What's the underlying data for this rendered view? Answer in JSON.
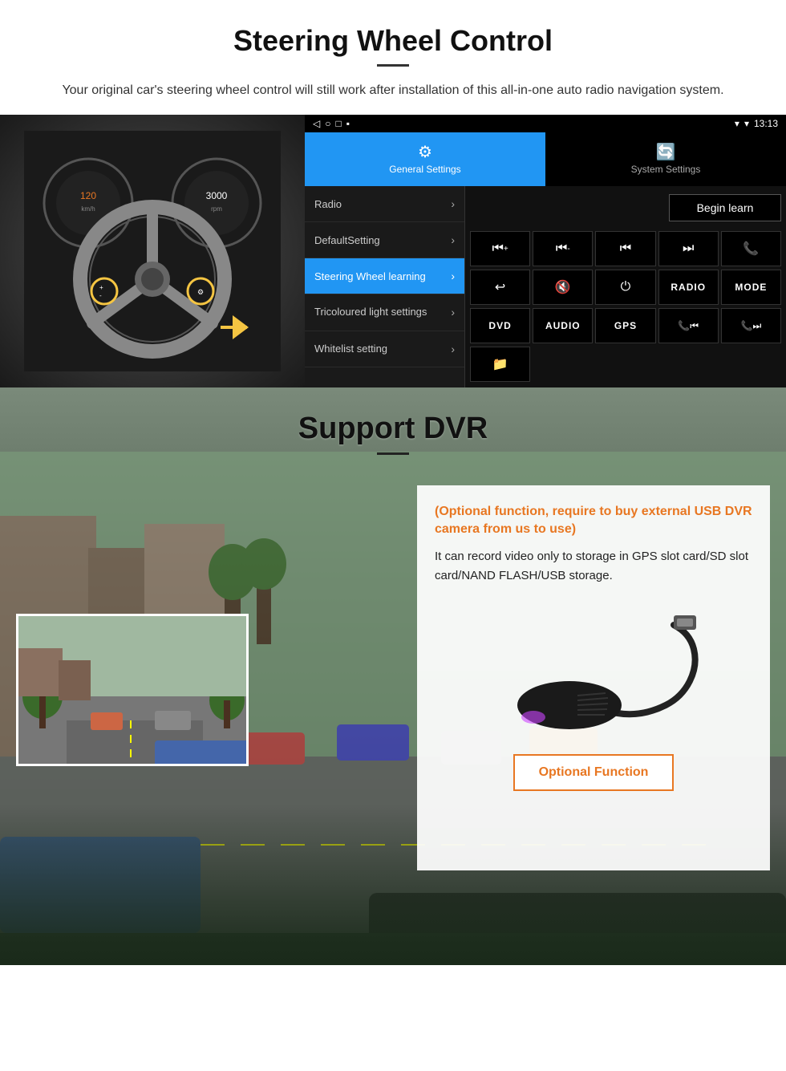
{
  "steering": {
    "title": "Steering Wheel Control",
    "description": "Your original car's steering wheel control will still work after installation of this all-in-one auto radio navigation system.",
    "statusbar": {
      "time": "13:13",
      "signal": "▾",
      "wifi": "▾"
    },
    "tabs": [
      {
        "label": "General Settings",
        "icon": "⚙",
        "active": true
      },
      {
        "label": "System Settings",
        "icon": "🔄",
        "active": false
      }
    ],
    "menu_items": [
      {
        "label": "Radio",
        "selected": false
      },
      {
        "label": "DefaultSetting",
        "selected": false
      },
      {
        "label": "Steering Wheel learning",
        "selected": true
      },
      {
        "label": "Tricoloured light settings",
        "selected": false
      },
      {
        "label": "Whitelist setting",
        "selected": false
      }
    ],
    "begin_learn_label": "Begin learn",
    "control_buttons": [
      {
        "label": "⏮+",
        "row": 1
      },
      {
        "label": "⏮-",
        "row": 1
      },
      {
        "label": "⏮",
        "row": 1
      },
      {
        "label": "⏭",
        "row": 1
      },
      {
        "label": "📞",
        "row": 1
      },
      {
        "label": "↩",
        "row": 2
      },
      {
        "label": "🔇",
        "row": 2
      },
      {
        "label": "⏻",
        "row": 2
      },
      {
        "label": "RADIO",
        "row": 2,
        "wide": true
      },
      {
        "label": "MODE",
        "row": 2,
        "wide": true
      },
      {
        "label": "DVD",
        "row": 3,
        "wide": true
      },
      {
        "label": "AUDIO",
        "row": 3,
        "wide": true
      },
      {
        "label": "GPS",
        "row": 3,
        "wide": true
      },
      {
        "label": "📞⏮",
        "row": 3
      },
      {
        "label": "📞⏭",
        "row": 3
      },
      {
        "label": "📁",
        "row": 4
      }
    ]
  },
  "dvr": {
    "title": "Support DVR",
    "optional_text": "(Optional function, require to buy external USB DVR camera from us to use)",
    "desc_text": "It can record video only to storage in GPS slot card/SD slot card/NAND FLASH/USB storage.",
    "optional_function_label": "Optional Function"
  }
}
